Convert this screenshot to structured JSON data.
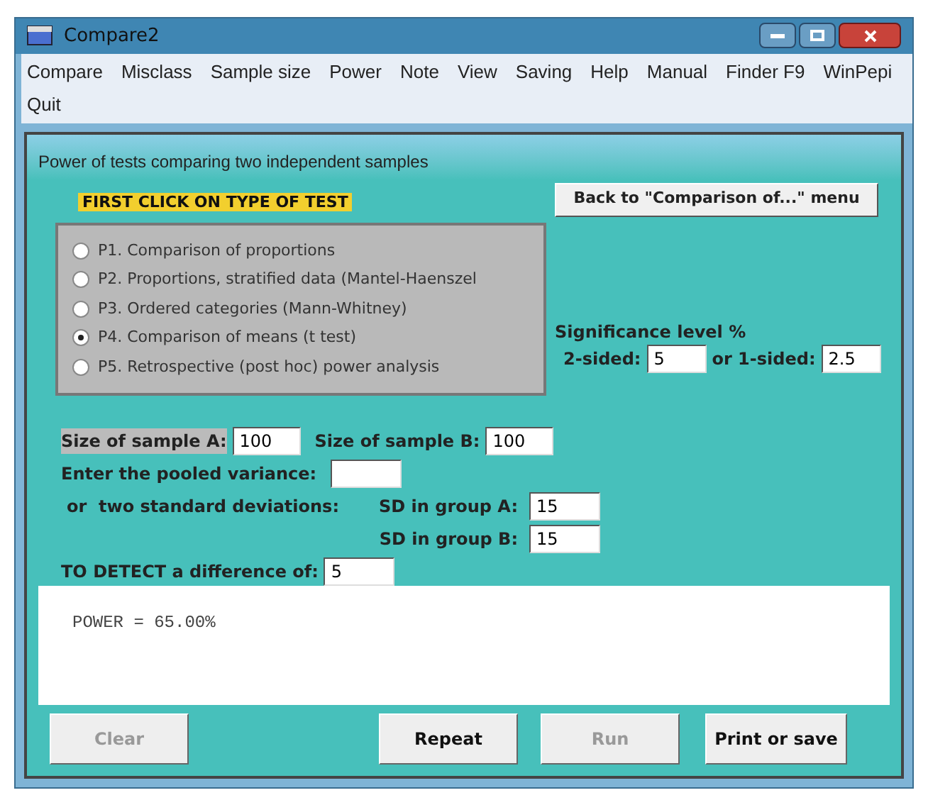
{
  "window": {
    "title": "Compare2"
  },
  "menu": [
    {
      "label": "Compare"
    },
    {
      "label": "Misclass"
    },
    {
      "label": "Sample size"
    },
    {
      "label": "Power"
    },
    {
      "label": "Note"
    },
    {
      "label": "View"
    },
    {
      "label": "Saving"
    },
    {
      "label": "Help"
    },
    {
      "label": "Manual"
    },
    {
      "label": "Finder F9"
    },
    {
      "label": "WinPepi"
    },
    {
      "label": "Quit"
    }
  ],
  "panel": {
    "title": "Power of tests comparing  two independent samples",
    "instruction": "FIRST CLICK ON TYPE OF TEST",
    "back_button": "Back to \"Comparison of...\" menu"
  },
  "test_types": [
    {
      "label": "P1. Comparison of proportions",
      "selected": false
    },
    {
      "label": "P2. Proportions, stratified data (Mantel-Haenszel",
      "selected": false
    },
    {
      "label": "P3. Ordered categories (Mann-Whitney)",
      "selected": false
    },
    {
      "label": "P4. Comparison of means (t test)",
      "selected": true
    },
    {
      "label": "P5. Retrospective (post hoc) power analysis",
      "selected": false
    }
  ],
  "significance": {
    "label": "Significance level %",
    "two_sided_label": "2-sided:",
    "two_sided": "5",
    "one_sided_label": "or 1-sided:",
    "one_sided": "2.5"
  },
  "inputs": {
    "sample_a_label": "Size of sample A:",
    "sample_a": "100",
    "sample_b_label": "Size of sample B:",
    "sample_b": "100",
    "pooled_label": "Enter the pooled variance:",
    "sd_label": "or  two standard deviations:",
    "sd_a_label": "SD in group A:",
    "sd_a": "15",
    "sd_b_label": "SD in group B:",
    "sd_b": "15",
    "detect_label": "TO DETECT a difference of:",
    "detect": "5"
  },
  "output": "POWER = 65.00%",
  "buttons": [
    {
      "label": "Clear",
      "disabled": true
    },
    {
      "label": "Repeat",
      "disabled": false
    },
    {
      "label": "Run",
      "disabled": true
    },
    {
      "label": "Print or save",
      "disabled": false
    }
  ]
}
